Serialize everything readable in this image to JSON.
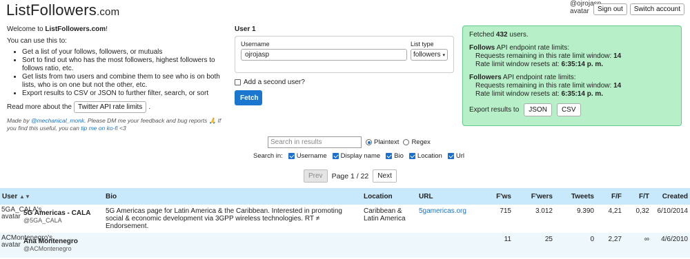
{
  "header": {
    "brand": "ListFollowers",
    "tld": ".com",
    "user_handle": "@ojrojasp",
    "avatar_text": "avatar",
    "sign_out": "Sign out",
    "switch_account": "Switch account"
  },
  "intro": {
    "welcome_prefix": "Welcome to ",
    "welcome_site": "ListFollowers.com",
    "welcome_suffix": "!",
    "use_this": "You can use this to:",
    "bullets": [
      "Get a list of your follows, followers, or mutuals",
      "Sort to find out who has the most followers, highest followers to follows ratio, etc.",
      "Get lists from two users and combine them to see who is on both lists, who is on one but not the other, etc.",
      "Export results to CSV or JSON to further filter, search, or sort"
    ],
    "read_more": "Read more about the",
    "rate_limits_button": "Twitter API rate limits",
    "period": ".",
    "credit_made_by": "Made by ",
    "credit_author": "@mechanical_monk",
    "credit_mid": ". Please DM me your feedback and bug reports 🙏 If you find this useful, you can ",
    "credit_tip": "tip me on ko-fi",
    "credit_end": " <3"
  },
  "user1": {
    "title": "User 1",
    "username_label": "Username",
    "username_value": "ojrojasp",
    "list_type_label": "List type",
    "list_type_value": "followers",
    "add_second": "Add a second user?",
    "fetch": "Fetch"
  },
  "status": {
    "fetched_prefix": "Fetched ",
    "fetched_count": "432",
    "fetched_suffix": " users.",
    "follows_title": "Follows",
    "followers_title": "Followers",
    "limits_label": " API endpoint rate limits:",
    "remaining_label": "Requests remaining in this rate limit window: ",
    "resets_label": "Rate limit window resets at: ",
    "follows_remaining": "14",
    "follows_reset": "6:35:14 p. m.",
    "followers_remaining": "14",
    "followers_reset": "6:35:14 p. m.",
    "export_label": "Export results to",
    "json": "JSON",
    "csv": "CSV"
  },
  "search": {
    "placeholder": "Search in results",
    "plaintext": "Plaintext",
    "regex": "Regex",
    "search_in": "Search in:",
    "fields": [
      "Username",
      "Display name",
      "Bio",
      "Location",
      "Url"
    ]
  },
  "pager": {
    "prev": "Prev",
    "page": "Page 1 / 22",
    "next": "Next"
  },
  "table": {
    "headers": {
      "user": "User",
      "bio": "Bio",
      "location": "Location",
      "url": "URL",
      "fws": "F'ws",
      "fwers": "F'wers",
      "tweets": "Tweets",
      "ff": "F/F",
      "ft": "F/T",
      "created": "Created"
    },
    "rows": [
      {
        "avatar": "5GA_CALA's avatar",
        "name": "5G Americas - CALA",
        "handle": "@5GA_CALA",
        "bio": "5G Americas page for Latin America & the Caribbean. Interested in promoting social & economic development via 3GPP wireless technologies.   RT ≠ Endorsement.",
        "location": "Caribbean & Latin America",
        "url": "5gamericas.org",
        "fws": "715",
        "fwers": "3.012",
        "tweets": "9.390",
        "ff": "4,21",
        "ft": "0,32",
        "created": "6/10/2014"
      },
      {
        "avatar": "ACMontenegro's avatar",
        "name": "Ana Montenegro",
        "handle": "@ACMontenegro",
        "bio": "",
        "location": "",
        "url": "",
        "fws": "11",
        "fwers": "25",
        "tweets": "0",
        "ff": "2,27",
        "ft": "∞",
        "created": "4/6/2010"
      }
    ]
  },
  "colors": {
    "accent": "#1a76cf",
    "status_bg": "#b7f0c8",
    "table_header": "#c8e9fb"
  }
}
